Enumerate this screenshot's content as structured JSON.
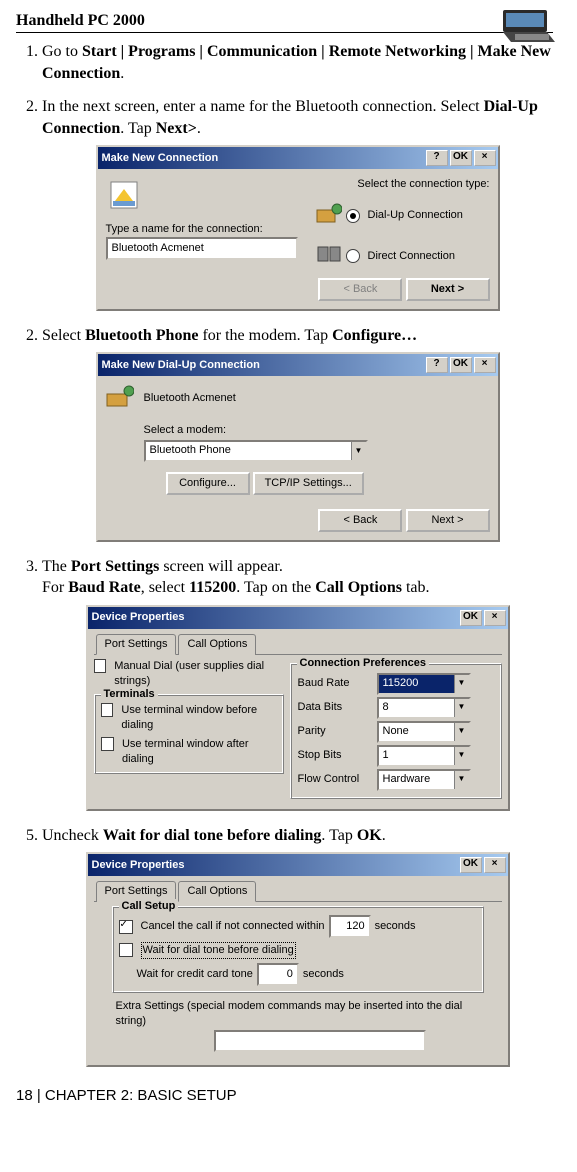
{
  "page": {
    "title": "Handheld PC 2000",
    "footer": "18 | CHAPTER 2: BASIC SETUP"
  },
  "steps": {
    "s1_pre": "Go to ",
    "s1_bold": "Start | Programs | Communication | Remote Networking | Make New Connection",
    "s1_post": ".",
    "s2a": "In the next screen, enter a name for the Bluetooth connection. Select ",
    "s2b": "Dial-Up Connection",
    "s2c": ". Tap ",
    "s2d": "Next>",
    "s2e": ".",
    "s3a": "Select ",
    "s3b": "Bluetooth Phone",
    "s3c": " for the modem. Tap ",
    "s3d": "Configure…",
    "s4a": "The ",
    "s4b": "Port Settings",
    "s4c": " screen will appear.",
    "s4d": "For ",
    "s4e": "Baud Rate",
    "s4f": ", select ",
    "s4g": "115200",
    "s4h": ". Tap on the ",
    "s4i": "Call Options",
    "s4j": " tab.",
    "s5a": "Uncheck ",
    "s5b": "Wait for dial tone before dialing",
    "s5c": ". Tap ",
    "s5d": "OK",
    "s5e": "."
  },
  "dlg1": {
    "title": "Make New Connection",
    "btn_help": "?",
    "btn_ok": "OK",
    "btn_close": "×",
    "label_type": "Type a name for the connection:",
    "input_name": "Bluetooth Acmenet",
    "label_select": "Select the connection type:",
    "opt_dialup": "Dial-Up Connection",
    "opt_direct": "Direct Connection",
    "btn_back": "< Back",
    "btn_next": "Next >"
  },
  "dlg2": {
    "title": "Make New Dial-Up Connection",
    "btn_help": "?",
    "btn_ok": "OK",
    "btn_close": "×",
    "conn_name": "Bluetooth Acmenet",
    "label_modem": "Select a modem:",
    "modem": "Bluetooth Phone",
    "btn_configure": "Configure...",
    "btn_tcpip": "TCP/IP Settings...",
    "btn_back": "< Back",
    "btn_next": "Next >"
  },
  "dlg3": {
    "title": "Device Properties",
    "btn_ok": "OK",
    "btn_close": "×",
    "tab_port": "Port Settings",
    "tab_call": "Call Options",
    "chk_manual": "Manual Dial (user supplies dial strings)",
    "grp_terminals": "Terminals",
    "chk_term_before": "Use terminal window before dialing",
    "chk_term_after": "Use terminal window after dialing",
    "grp_conn": "Connection Preferences",
    "lbl_baud": "Baud Rate",
    "val_baud": "115200",
    "lbl_data": "Data Bits",
    "val_data": "8",
    "lbl_parity": "Parity",
    "val_parity": "None",
    "lbl_stop": "Stop Bits",
    "val_stop": "1",
    "lbl_flow": "Flow Control",
    "val_flow": "Hardware"
  },
  "dlg4": {
    "title": "Device Properties",
    "btn_ok": "OK",
    "btn_close": "×",
    "tab_port": "Port Settings",
    "tab_call": "Call Options",
    "grp_call": "Call Setup",
    "chk_cancel": "Cancel the call if not connected within",
    "val_cancel": "120",
    "lbl_seconds": "seconds",
    "chk_wait": "Wait for dial tone before dialing",
    "lbl_credit": "Wait for credit card tone",
    "val_credit": "0",
    "lbl_extra": "Extra Settings (special modem commands may be inserted into the dial string)",
    "val_extra": ""
  }
}
